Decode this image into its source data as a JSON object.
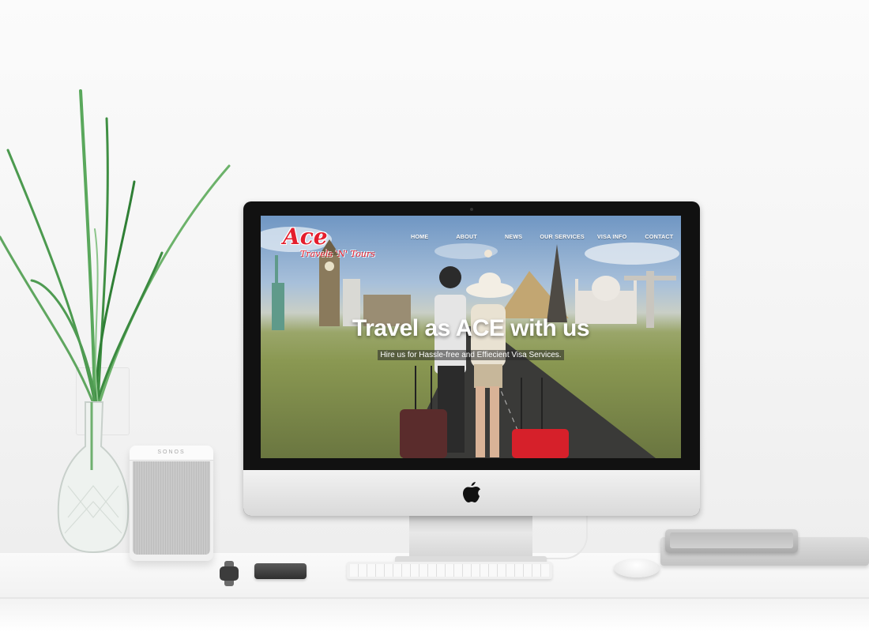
{
  "website": {
    "logo": {
      "main": "Ace",
      "tagline": "Travels 'N' Tours"
    },
    "nav": [
      {
        "id": "home",
        "label": "HOME"
      },
      {
        "id": "about",
        "label": "ABOUT"
      },
      {
        "id": "news",
        "label": "NEWS"
      },
      {
        "id": "services",
        "label": "OUR SERVICES"
      },
      {
        "id": "visa",
        "label": "VISA INFO"
      },
      {
        "id": "contact",
        "label": "CONTACT"
      }
    ],
    "hero": {
      "title": "Travel as ACE with us",
      "subtitle": "Hire us for Hassle-free and Effiecient Visa Services."
    }
  },
  "devices": {
    "speaker_brand": "SONOS"
  },
  "colors": {
    "brand_red": "#e41e2d",
    "nav_text": "#ffffff"
  },
  "icons": [
    "apple-logo-icon"
  ]
}
